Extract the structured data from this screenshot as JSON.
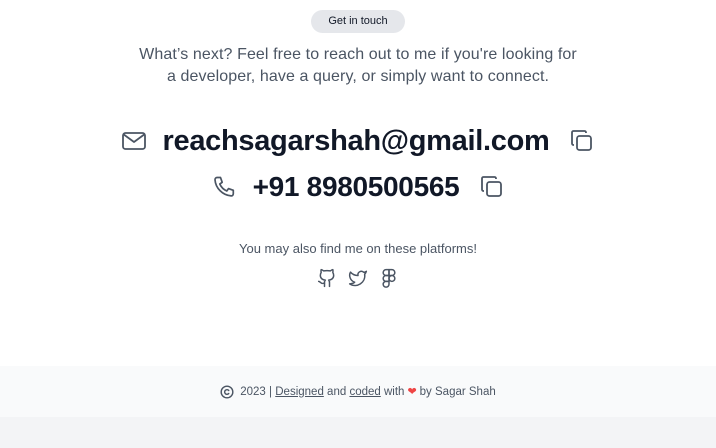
{
  "badge": {
    "label": "Get in touch"
  },
  "intro": {
    "line1": "What’s next? Feel free to reach out to me if you're looking for",
    "line2": "a developer, have a query, or simply want to connect."
  },
  "contacts": {
    "email": {
      "icon": "mail-icon",
      "value": "reachsagarshah@gmail.com",
      "copy_icon": "copy-icon"
    },
    "phone": {
      "icon": "phone-icon",
      "value": "+91 8980500565",
      "copy_icon": "copy-icon"
    }
  },
  "platforms": {
    "label": "You may also find me on these platforms!",
    "items": [
      {
        "icon": "github-icon"
      },
      {
        "icon": "twitter-icon"
      },
      {
        "icon": "figma-icon"
      }
    ]
  },
  "footer": {
    "icon": "copyright-icon",
    "year": "2023",
    "separator": "|",
    "designed": "Designed",
    "and": "and",
    "coded": "coded",
    "with": "with",
    "by": "by Sagar Shah"
  },
  "colors": {
    "text_primary": "#111827",
    "text_secondary": "#4b5563",
    "badge_bg": "#e5e7eb",
    "footer_bg": "#f9fafb",
    "heart": "#ef4444"
  }
}
